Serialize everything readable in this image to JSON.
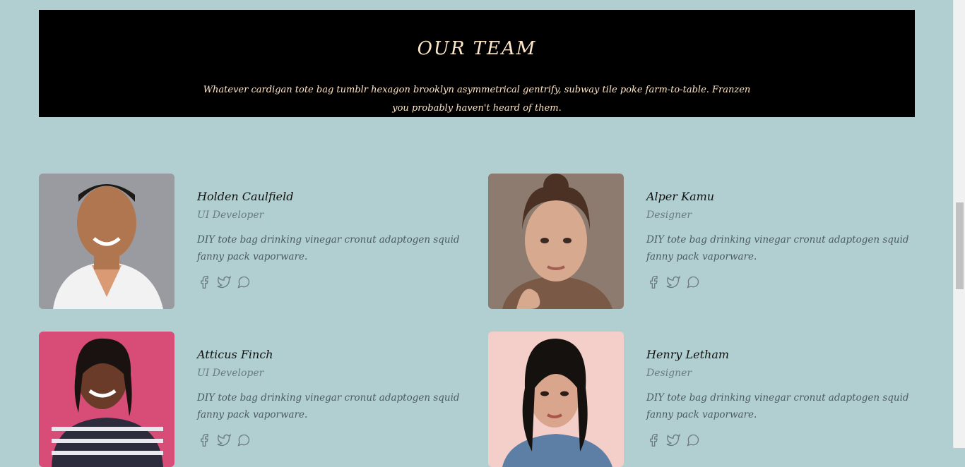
{
  "hero": {
    "title": "OUR TEAM",
    "description": "Whatever cardigan tote bag tumblr hexagon brooklyn asymmetrical gentrify, subway tile poke farm-to-table. Franzen you probably haven't heard of them."
  },
  "members": [
    {
      "name": "Holden Caulfield",
      "role": "UI Developer",
      "bio": "DIY tote bag drinking vinegar cronut adaptogen squid fanny pack vaporware."
    },
    {
      "name": "Alper Kamu",
      "role": "Designer",
      "bio": "DIY tote bag drinking vinegar cronut adaptogen squid fanny pack vaporware."
    },
    {
      "name": "Atticus Finch",
      "role": "UI Developer",
      "bio": "DIY tote bag drinking vinegar cronut adaptogen squid fanny pack vaporware."
    },
    {
      "name": "Henry Letham",
      "role": "Designer",
      "bio": "DIY tote bag drinking vinegar cronut adaptogen squid fanny pack vaporware."
    }
  ],
  "social_icons": [
    "facebook-icon",
    "twitter-icon",
    "chat-icon"
  ]
}
